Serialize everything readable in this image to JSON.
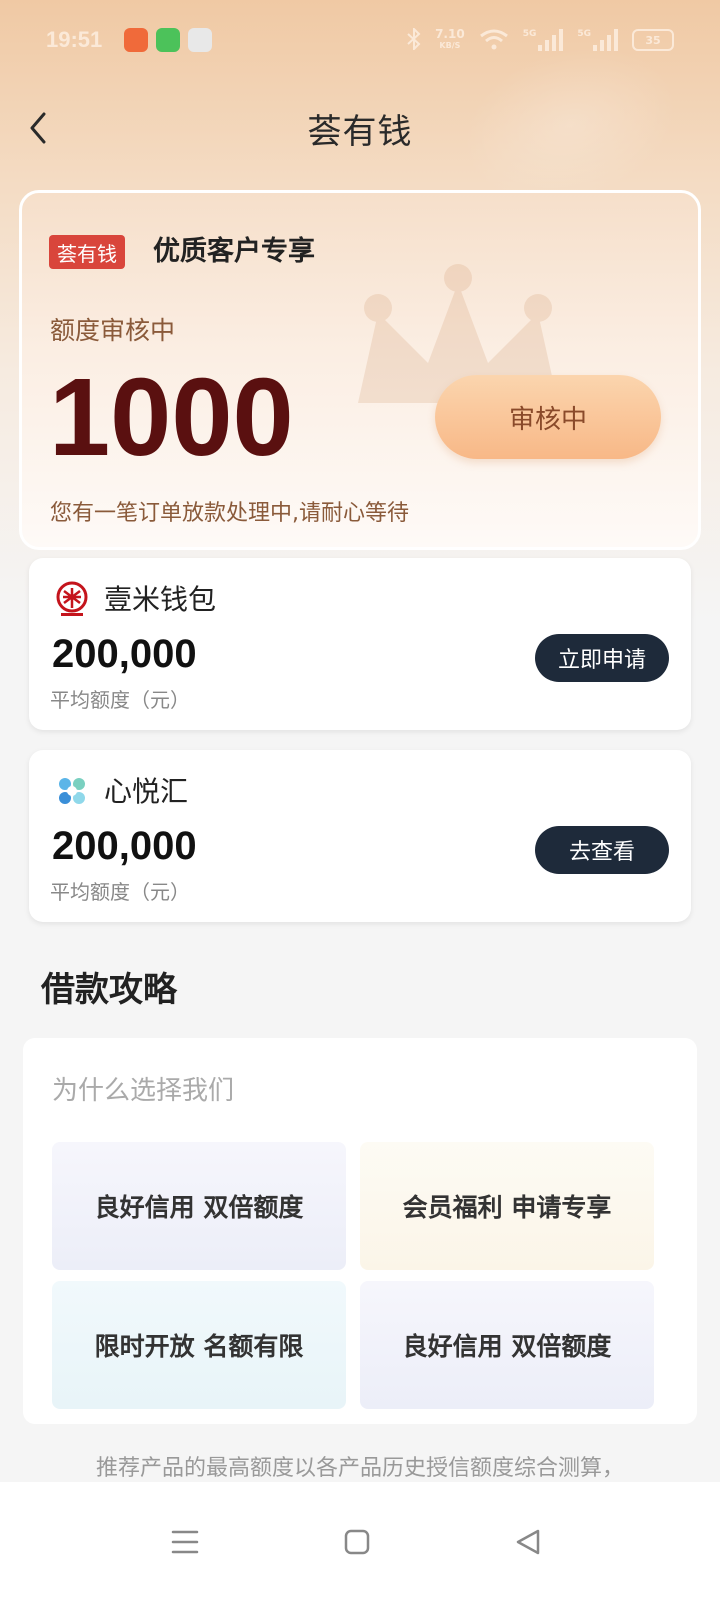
{
  "status_bar": {
    "time": "19:51",
    "speed": "7.10",
    "speed_unit": "KB/S",
    "network": "5G",
    "battery": "35"
  },
  "nav": {
    "title": "荟有钱"
  },
  "hero": {
    "tag": "荟有钱",
    "tag_title": "优质客户专享",
    "status_label": "额度审核中",
    "amount": "1000",
    "button_label": "审核中",
    "note": "您有一笔订单放款处理中,请耐心等待"
  },
  "products": [
    {
      "name": "壹米钱包",
      "amount": "200,000",
      "sub": "平均额度（元）",
      "button": "立即申请",
      "logo_icon": "mi-logo-icon"
    },
    {
      "name": "心悦汇",
      "amount": "200,000",
      "sub": "平均额度（元）",
      "button": "去查看",
      "logo_icon": "flower-logo-icon"
    }
  ],
  "guide": {
    "title": "借款攻略",
    "why_title": "为什么选择我们",
    "tiles": [
      "良好信用 双倍额度",
      "会员福利 申请专享",
      "限时开放 名额有限",
      "良好信用 双倍额度"
    ]
  },
  "disclaimer": "推荐产品的最高额度以各产品历史授信额度综合测算，",
  "colors": {
    "accent_red": "#d9453b",
    "amount_dark_red": "#5a1010",
    "button_dark": "#1e2a3a",
    "hero_button": "#f8b887"
  }
}
